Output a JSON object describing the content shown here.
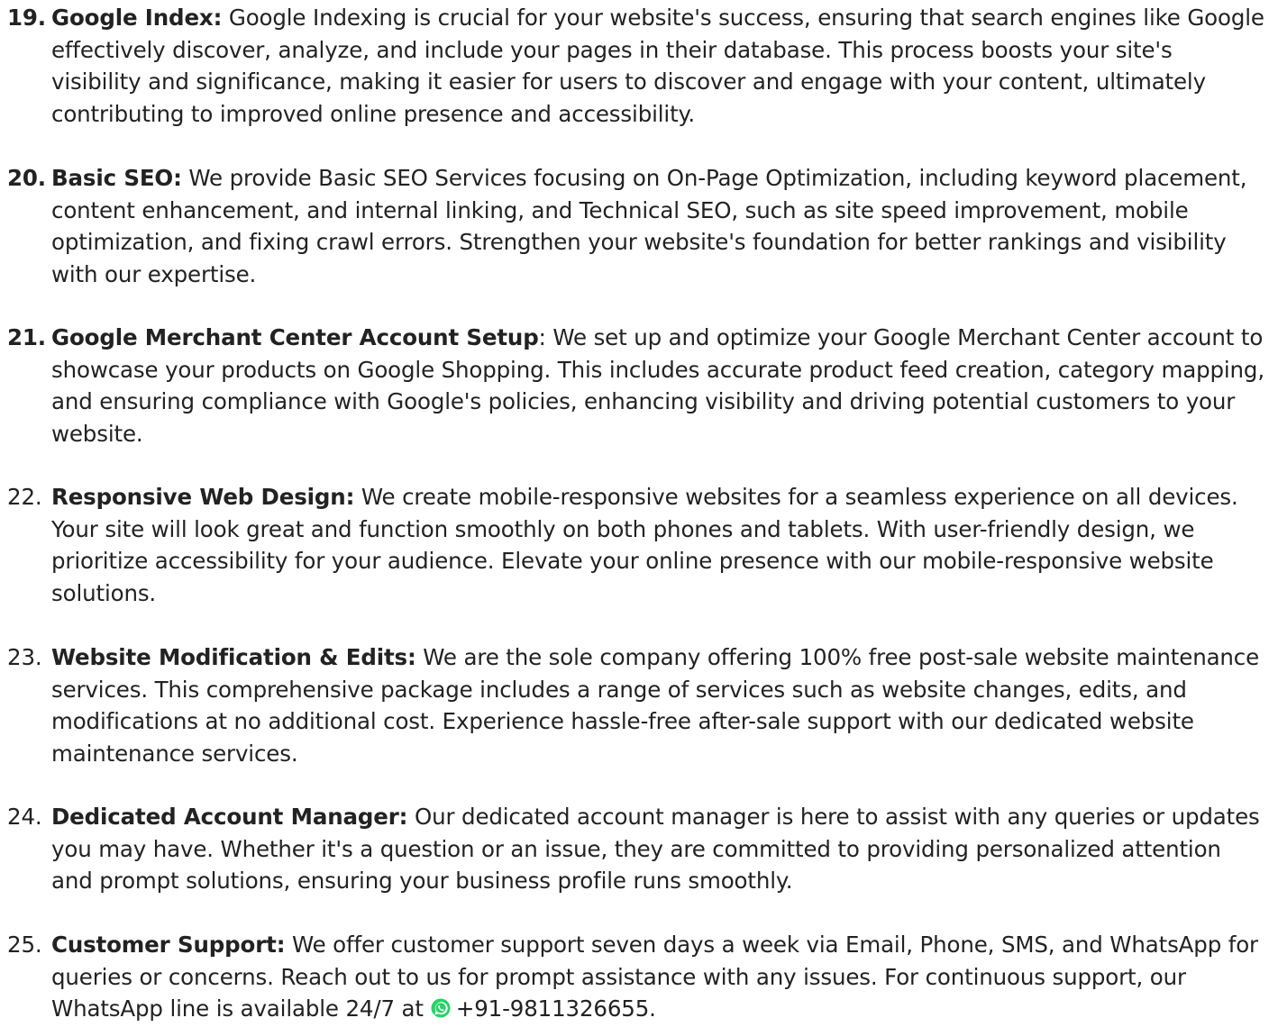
{
  "services": [
    {
      "number": "19.",
      "title": "Google Index:",
      "text": " Google Indexing is crucial for your website's success, ensuring that search engines like Google effectively discover, analyze, and include your pages in their database. This process boosts your site's visibility and significance, making it easier for users to discover and engage with your content, ultimately contributing to improved online presence and accessibility."
    },
    {
      "number": "20.",
      "title": "Basic SEO:",
      "text": " We provide Basic SEO Services focusing on On-Page Optimization, including keyword placement, content enhancement, and internal linking, and Technical SEO, such as site speed improvement, mobile optimization, and fixing crawl errors. Strengthen your website's foundation for better rankings and visibility with our expertise."
    },
    {
      "number": "21.",
      "title": "Google Merchant Center Account Setup",
      "text": ": We set up and optimize your Google Merchant Center account to showcase your products on Google Shopping. This includes accurate product feed creation, category mapping, and ensuring compliance with Google's policies, enhancing visibility and driving potential customers to your website."
    },
    {
      "number": "22.",
      "title": "Responsive Web Design:",
      "text": " We create mobile-responsive websites for a seamless experience on all devices. Your site will look great and function smoothly on both phones and tablets. With user-friendly design, we prioritize accessibility for your audience. Elevate your online presence with our mobile-responsive website solutions."
    },
    {
      "number": "23.",
      "title": "Website Modification & Edits:",
      "text": " We are the sole company offering 100% free post-sale website maintenance services. This comprehensive package includes a range of services such as website changes, edits, and modifications at no additional cost. Experience hassle-free after-sale support with our dedicated website maintenance services."
    },
    {
      "number": "24.",
      "title": "Dedicated Account Manager:",
      "text": " Our dedicated account manager is here to assist with any queries or updates you may have. Whether it's a question or an issue, they are committed to providing personalized attention and prompt solutions, ensuring your business profile runs smoothly."
    },
    {
      "number": "25.",
      "title": "Customer Support:",
      "text": " We offer customer support seven days a week via Email, Phone, SMS, and WhatsApp for queries or concerns. Reach out to us for prompt assistance with any issues. For continuous support, our WhatsApp line is available 24/7 at",
      "icon": "whatsapp-icon",
      "phone": "+91-9811326655."
    }
  ],
  "colors": {
    "text": "#222222",
    "whatsapp_green": "#25D366"
  }
}
